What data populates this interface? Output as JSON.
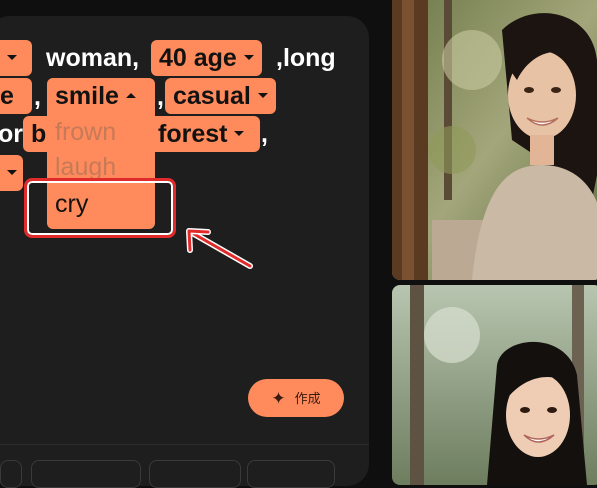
{
  "prompt": {
    "chip_top_left_1": "",
    "text_woman": "woman,",
    "chip_age": "40 age",
    "text_long": ",long",
    "chip_left_2": "e",
    "comma_a": ",",
    "chip_smile": "smile",
    "comma_b": ",",
    "chip_casual": "casual",
    "text_or": "or",
    "chip_b": "b",
    "chip_forest": "forest",
    "comma_c": ","
  },
  "dropdown": {
    "options": [
      "frown",
      "laugh",
      "cry"
    ],
    "selected": "cry"
  },
  "create_button": {
    "icon": "sparkle-icon",
    "label": "作成"
  },
  "images": [
    {
      "name": "generated-image-1",
      "description_icon": "woman-portrait"
    },
    {
      "name": "generated-image-2",
      "description_icon": "woman-portrait"
    }
  ],
  "annotation": {
    "highlight_color": "#e12b2b",
    "arrow_color": "#e12b2b"
  },
  "colors": {
    "accent": "#ff8a5b",
    "panel": "#1e1e1e",
    "background": "#0f0f0f"
  }
}
